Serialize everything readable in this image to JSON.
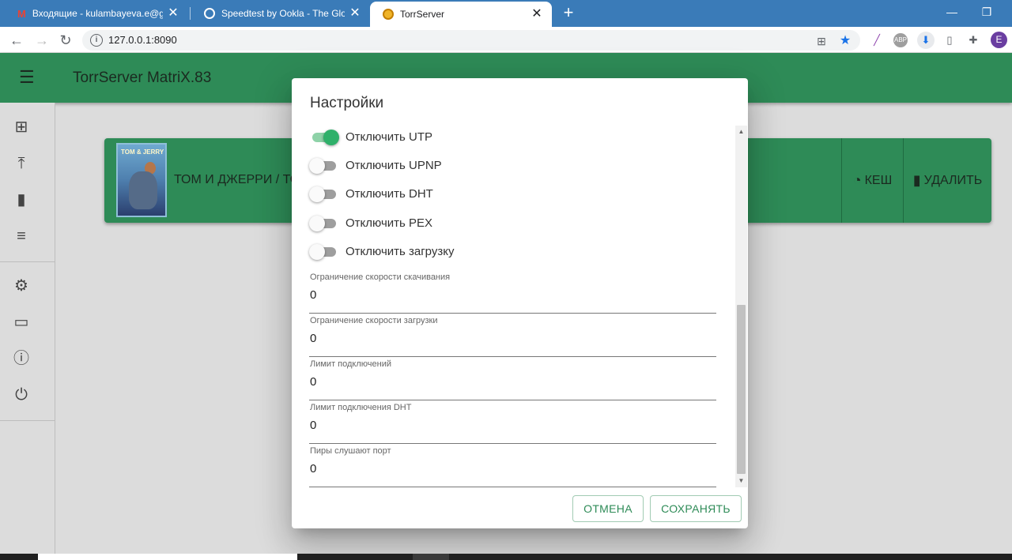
{
  "browser": {
    "tabs": [
      {
        "title": "Входящие - kulambayeva.e@gm",
        "icon": "gmail-icon"
      },
      {
        "title": "Speedtest by Ookla - The Global",
        "icon": "speedtest-icon"
      },
      {
        "title": "TorrServer",
        "icon": "torrserver-icon",
        "active": true
      }
    ],
    "close_glyph": "✕",
    "new_tab_glyph": "+",
    "minimize_glyph": "—",
    "restore_glyph": "❐",
    "url": "127.0.0.1:8090",
    "avatar_initial": "E"
  },
  "app": {
    "title": "TorrServer MatriX.83",
    "sidebar_icons": [
      "add-icon",
      "upload-icon",
      "delete-icon",
      "list-icon",
      "settings-icon",
      "card-icon",
      "info-icon",
      "power-icon"
    ]
  },
  "torrent_card": {
    "title": "ТОМ И ДЖЕРРИ / ТО",
    "poster_text": "TOM & JERRY",
    "cache_label": "КЕШ",
    "delete_label": "УДАЛИТЬ"
  },
  "settings_dialog": {
    "title": "Настройки",
    "switches": [
      {
        "label": "Отключить UTP",
        "checked": true
      },
      {
        "label": "Отключить UPNP",
        "checked": false
      },
      {
        "label": "Отключить DHT",
        "checked": false
      },
      {
        "label": "Отключить PEX",
        "checked": false
      },
      {
        "label": "Отключить загрузку",
        "checked": false
      }
    ],
    "fields": [
      {
        "label": "Ограничение скорости скачивания",
        "value": "0"
      },
      {
        "label": "Ограничение скорости загрузки",
        "value": "0"
      },
      {
        "label": "Лимит подключений",
        "value": "0"
      },
      {
        "label": "Лимит подключения DHT",
        "value": "0"
      },
      {
        "label": "Пиры слушают порт",
        "value": "0"
      }
    ],
    "cancel_label": "ОТМЕНА",
    "save_label": "СОХРАНЯТЬ"
  },
  "colors": {
    "accent": "#2e8b57",
    "switch_on": "#2fb06a",
    "tabbar": "#3a7bb8"
  }
}
